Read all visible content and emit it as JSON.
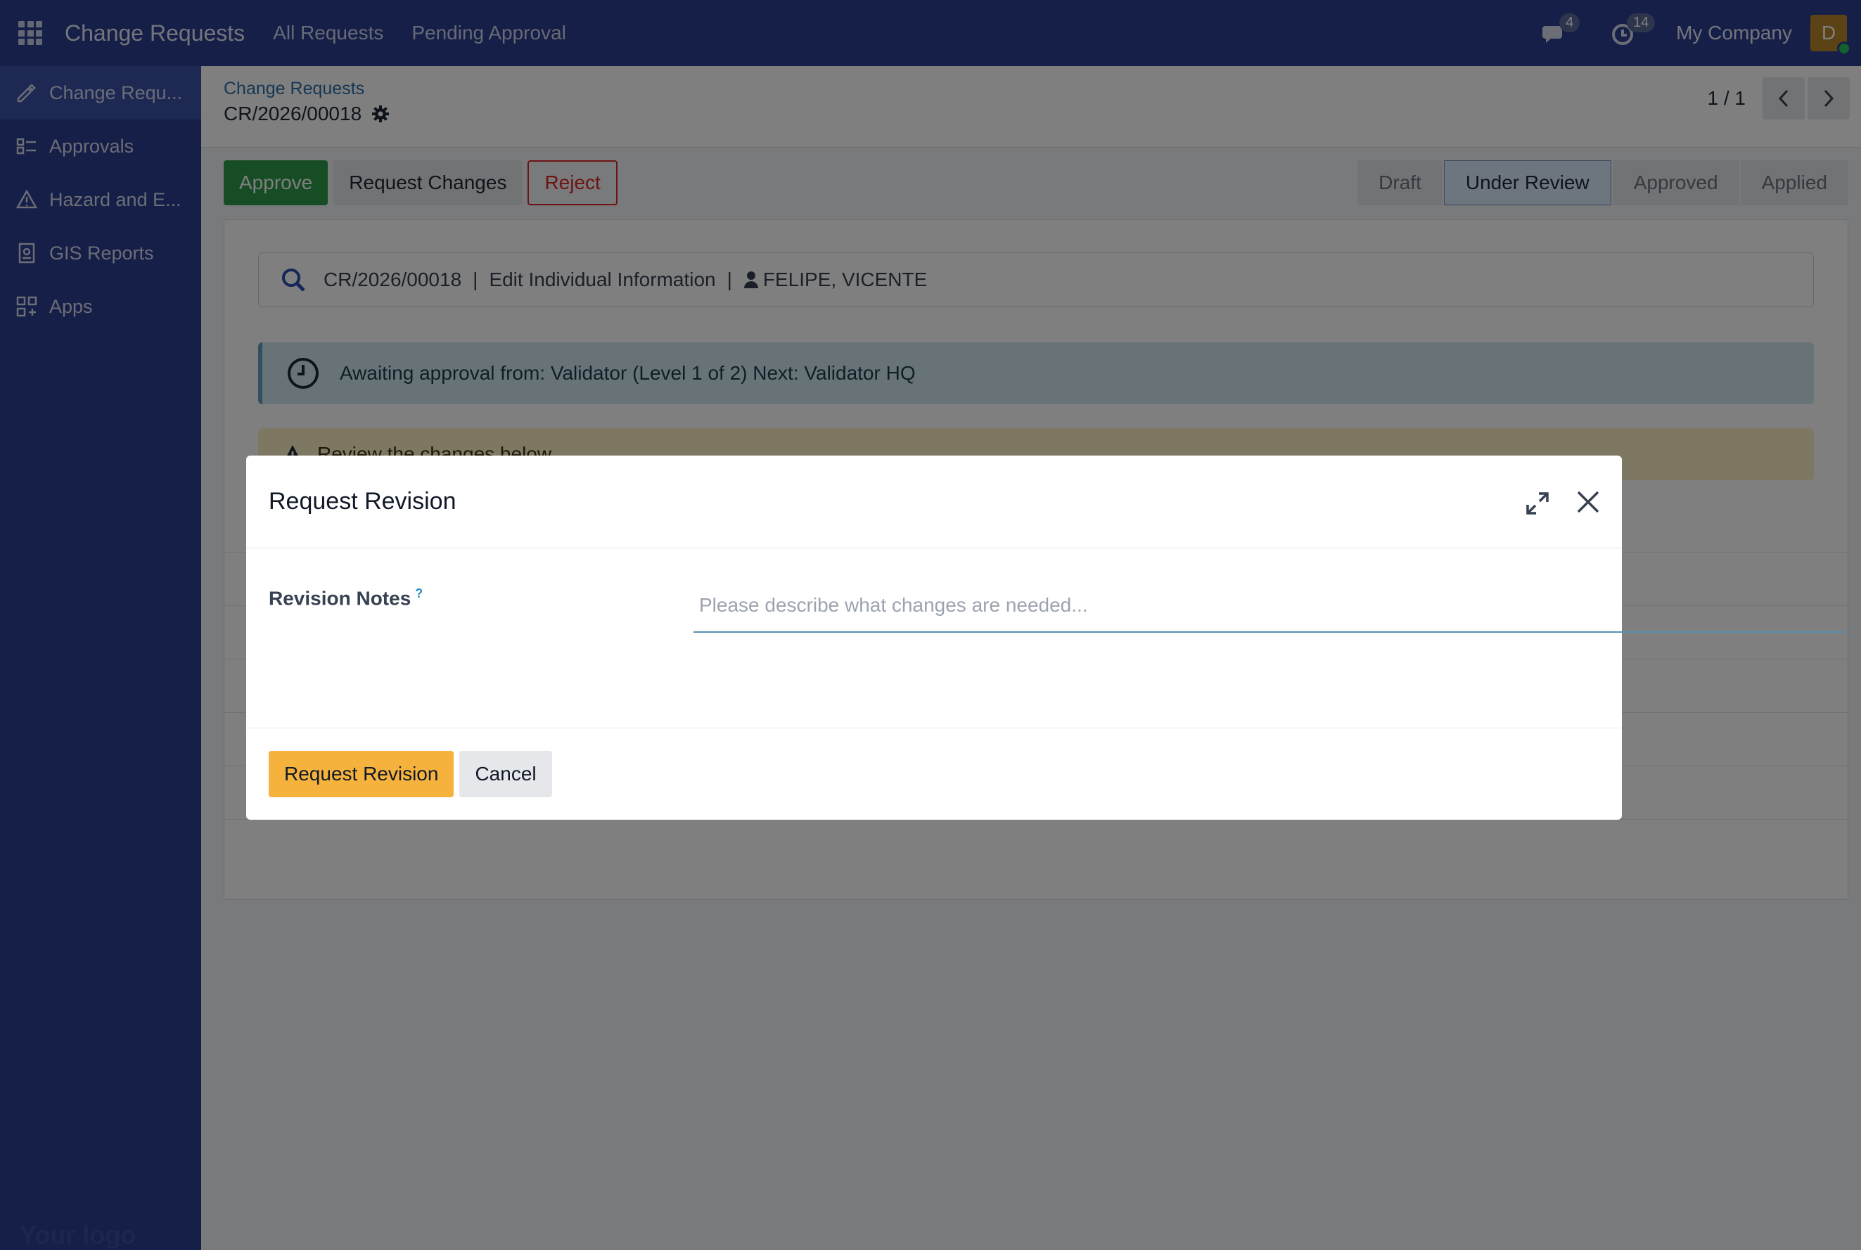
{
  "topbar": {
    "app_title": "Change Requests",
    "nav": [
      "All Requests",
      "Pending Approval"
    ],
    "messages_count": "4",
    "activities_count": "14",
    "company": "My Company",
    "avatar_initial": "D"
  },
  "sidebar": {
    "items": [
      {
        "label": "Change Requ...",
        "icon": "edit-check-icon"
      },
      {
        "label": "Approvals",
        "icon": "approvals-icon"
      },
      {
        "label": "Hazard and E...",
        "icon": "warning-icon"
      },
      {
        "label": "GIS Reports",
        "icon": "report-icon"
      },
      {
        "label": "Apps",
        "icon": "apps-icon"
      }
    ],
    "logo_text": "Your logo"
  },
  "control_panel": {
    "breadcrumb_parent": "Change Requests",
    "record_name": "CR/2026/00018",
    "pager": "1 / 1"
  },
  "actions": {
    "approve": "Approve",
    "request_changes": "Request Changes",
    "reject": "Reject"
  },
  "status_stages": [
    "Draft",
    "Under Review",
    "Approved",
    "Applied"
  ],
  "current_stage": "Under Review",
  "form": {
    "info_ref": "CR/2026/00018",
    "info_type": "Edit Individual Information",
    "info_person": "FELIPE, VICENTE",
    "approval_text": "Awaiting approval from: Validator (Level 1 of 2) Next: Validator HQ",
    "warning_text": "Review the changes below"
  },
  "modal": {
    "title": "Request Revision",
    "field_label": "Revision Notes",
    "field_help": "?",
    "placeholder": "Please describe what changes are needed...",
    "value": "",
    "primary_button": "Request Revision",
    "cancel_button": "Cancel"
  },
  "colors": {
    "nav_bg": "#2b3f8f",
    "approve": "#2f9a4a",
    "reject": "#dc2626",
    "primary_modal_btn": "#f5b33d"
  }
}
